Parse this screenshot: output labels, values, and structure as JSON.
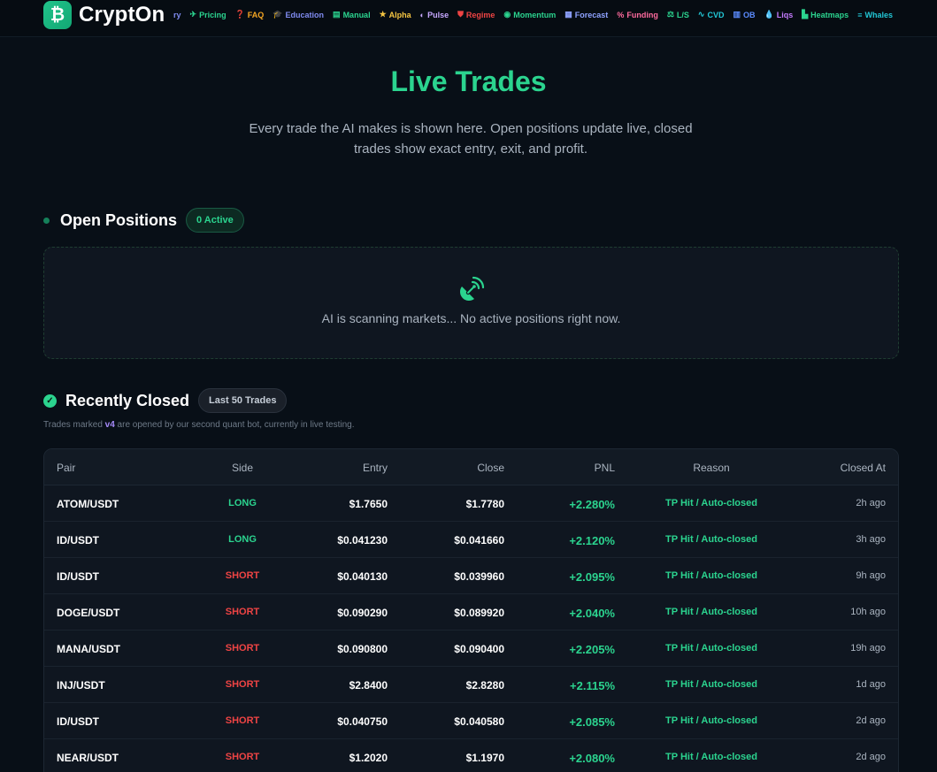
{
  "brand": {
    "name": "CryptOn",
    "logo_glyph": "₿"
  },
  "nav": {
    "items": [
      {
        "label": "ry",
        "icon": "",
        "color": "#7f8bf0"
      },
      {
        "label": "Pricing",
        "icon": "✈",
        "color": "#2bd48f"
      },
      {
        "label": "FAQ",
        "icon": "❓",
        "color": "#f5a623"
      },
      {
        "label": "Education",
        "icon": "🎓",
        "color": "#7f8bf0"
      },
      {
        "label": "Manual",
        "icon": "▤",
        "color": "#2bd48f"
      },
      {
        "label": "Alpha",
        "icon": "★",
        "color": "#f5c542"
      },
      {
        "label": "Pulse",
        "icon": "◐",
        "color": "#c7a8ff"
      },
      {
        "label": "Regime",
        "icon": "⛊",
        "color": "#ef4444"
      },
      {
        "label": "Momentum",
        "icon": "◉",
        "color": "#2bd48f"
      },
      {
        "label": "Forecast",
        "icon": "▦",
        "color": "#8ea2ff"
      },
      {
        "label": "Funding",
        "icon": "%",
        "color": "#ff6b9e"
      },
      {
        "label": "L/S",
        "icon": "⚖",
        "color": "#2bd48f"
      },
      {
        "label": "CVD",
        "icon": "∿",
        "color": "#22c7d6"
      },
      {
        "label": "OB",
        "icon": "▥",
        "color": "#5b8cff"
      },
      {
        "label": "Liqs",
        "icon": "💧",
        "color": "#c47bff"
      },
      {
        "label": "Heatmaps",
        "icon": "▙",
        "color": "#2bd48f"
      },
      {
        "label": "Whales",
        "icon": "≡",
        "color": "#22c7d6"
      }
    ]
  },
  "hero": {
    "title": "Live Trades",
    "subtitle": "Every trade the AI makes is shown here. Open positions update live, closed trades show exact entry, exit, and profit."
  },
  "open_positions": {
    "title": "Open Positions",
    "badge": "0 Active",
    "empty_icon": "satellite-dish-icon",
    "empty_text": "AI is scanning markets... No active positions right now."
  },
  "recently_closed": {
    "title": "Recently Closed",
    "badge": "Last 50 Trades",
    "note_prefix": "Trades marked ",
    "note_tag": "v4",
    "note_suffix": " are opened by our second quant bot, currently in live testing.",
    "columns": {
      "pair": "Pair",
      "side": "Side",
      "entry": "Entry",
      "close": "Close",
      "pnl": "PNL",
      "reason": "Reason",
      "closed_at": "Closed At"
    },
    "rows": [
      {
        "pair": "ATOM/USDT",
        "side": "LONG",
        "entry": "$1.7650",
        "close": "$1.7780",
        "pnl": "+2.280%",
        "reason": "TP Hit / Auto-closed",
        "closed_at": "2h ago"
      },
      {
        "pair": "ID/USDT",
        "side": "LONG",
        "entry": "$0.041230",
        "close": "$0.041660",
        "pnl": "+2.120%",
        "reason": "TP Hit / Auto-closed",
        "closed_at": "3h ago"
      },
      {
        "pair": "ID/USDT",
        "side": "SHORT",
        "entry": "$0.040130",
        "close": "$0.039960",
        "pnl": "+2.095%",
        "reason": "TP Hit / Auto-closed",
        "closed_at": "9h ago"
      },
      {
        "pair": "DOGE/USDT",
        "side": "SHORT",
        "entry": "$0.090290",
        "close": "$0.089920",
        "pnl": "+2.040%",
        "reason": "TP Hit / Auto-closed",
        "closed_at": "10h ago"
      },
      {
        "pair": "MANA/USDT",
        "side": "SHORT",
        "entry": "$0.090800",
        "close": "$0.090400",
        "pnl": "+2.205%",
        "reason": "TP Hit / Auto-closed",
        "closed_at": "19h ago"
      },
      {
        "pair": "INJ/USDT",
        "side": "SHORT",
        "entry": "$2.8400",
        "close": "$2.8280",
        "pnl": "+2.115%",
        "reason": "TP Hit / Auto-closed",
        "closed_at": "1d ago"
      },
      {
        "pair": "ID/USDT",
        "side": "SHORT",
        "entry": "$0.040750",
        "close": "$0.040580",
        "pnl": "+2.085%",
        "reason": "TP Hit / Auto-closed",
        "closed_at": "2d ago"
      },
      {
        "pair": "NEAR/USDT",
        "side": "SHORT",
        "entry": "$1.2020",
        "close": "$1.1970",
        "pnl": "+2.080%",
        "reason": "TP Hit / Auto-closed",
        "closed_at": "2d ago"
      }
    ]
  },
  "colors": {
    "accent": "#2bd48f",
    "long": "#2bd48f",
    "short": "#ef4444",
    "v4_tag": "#a78bfa"
  }
}
